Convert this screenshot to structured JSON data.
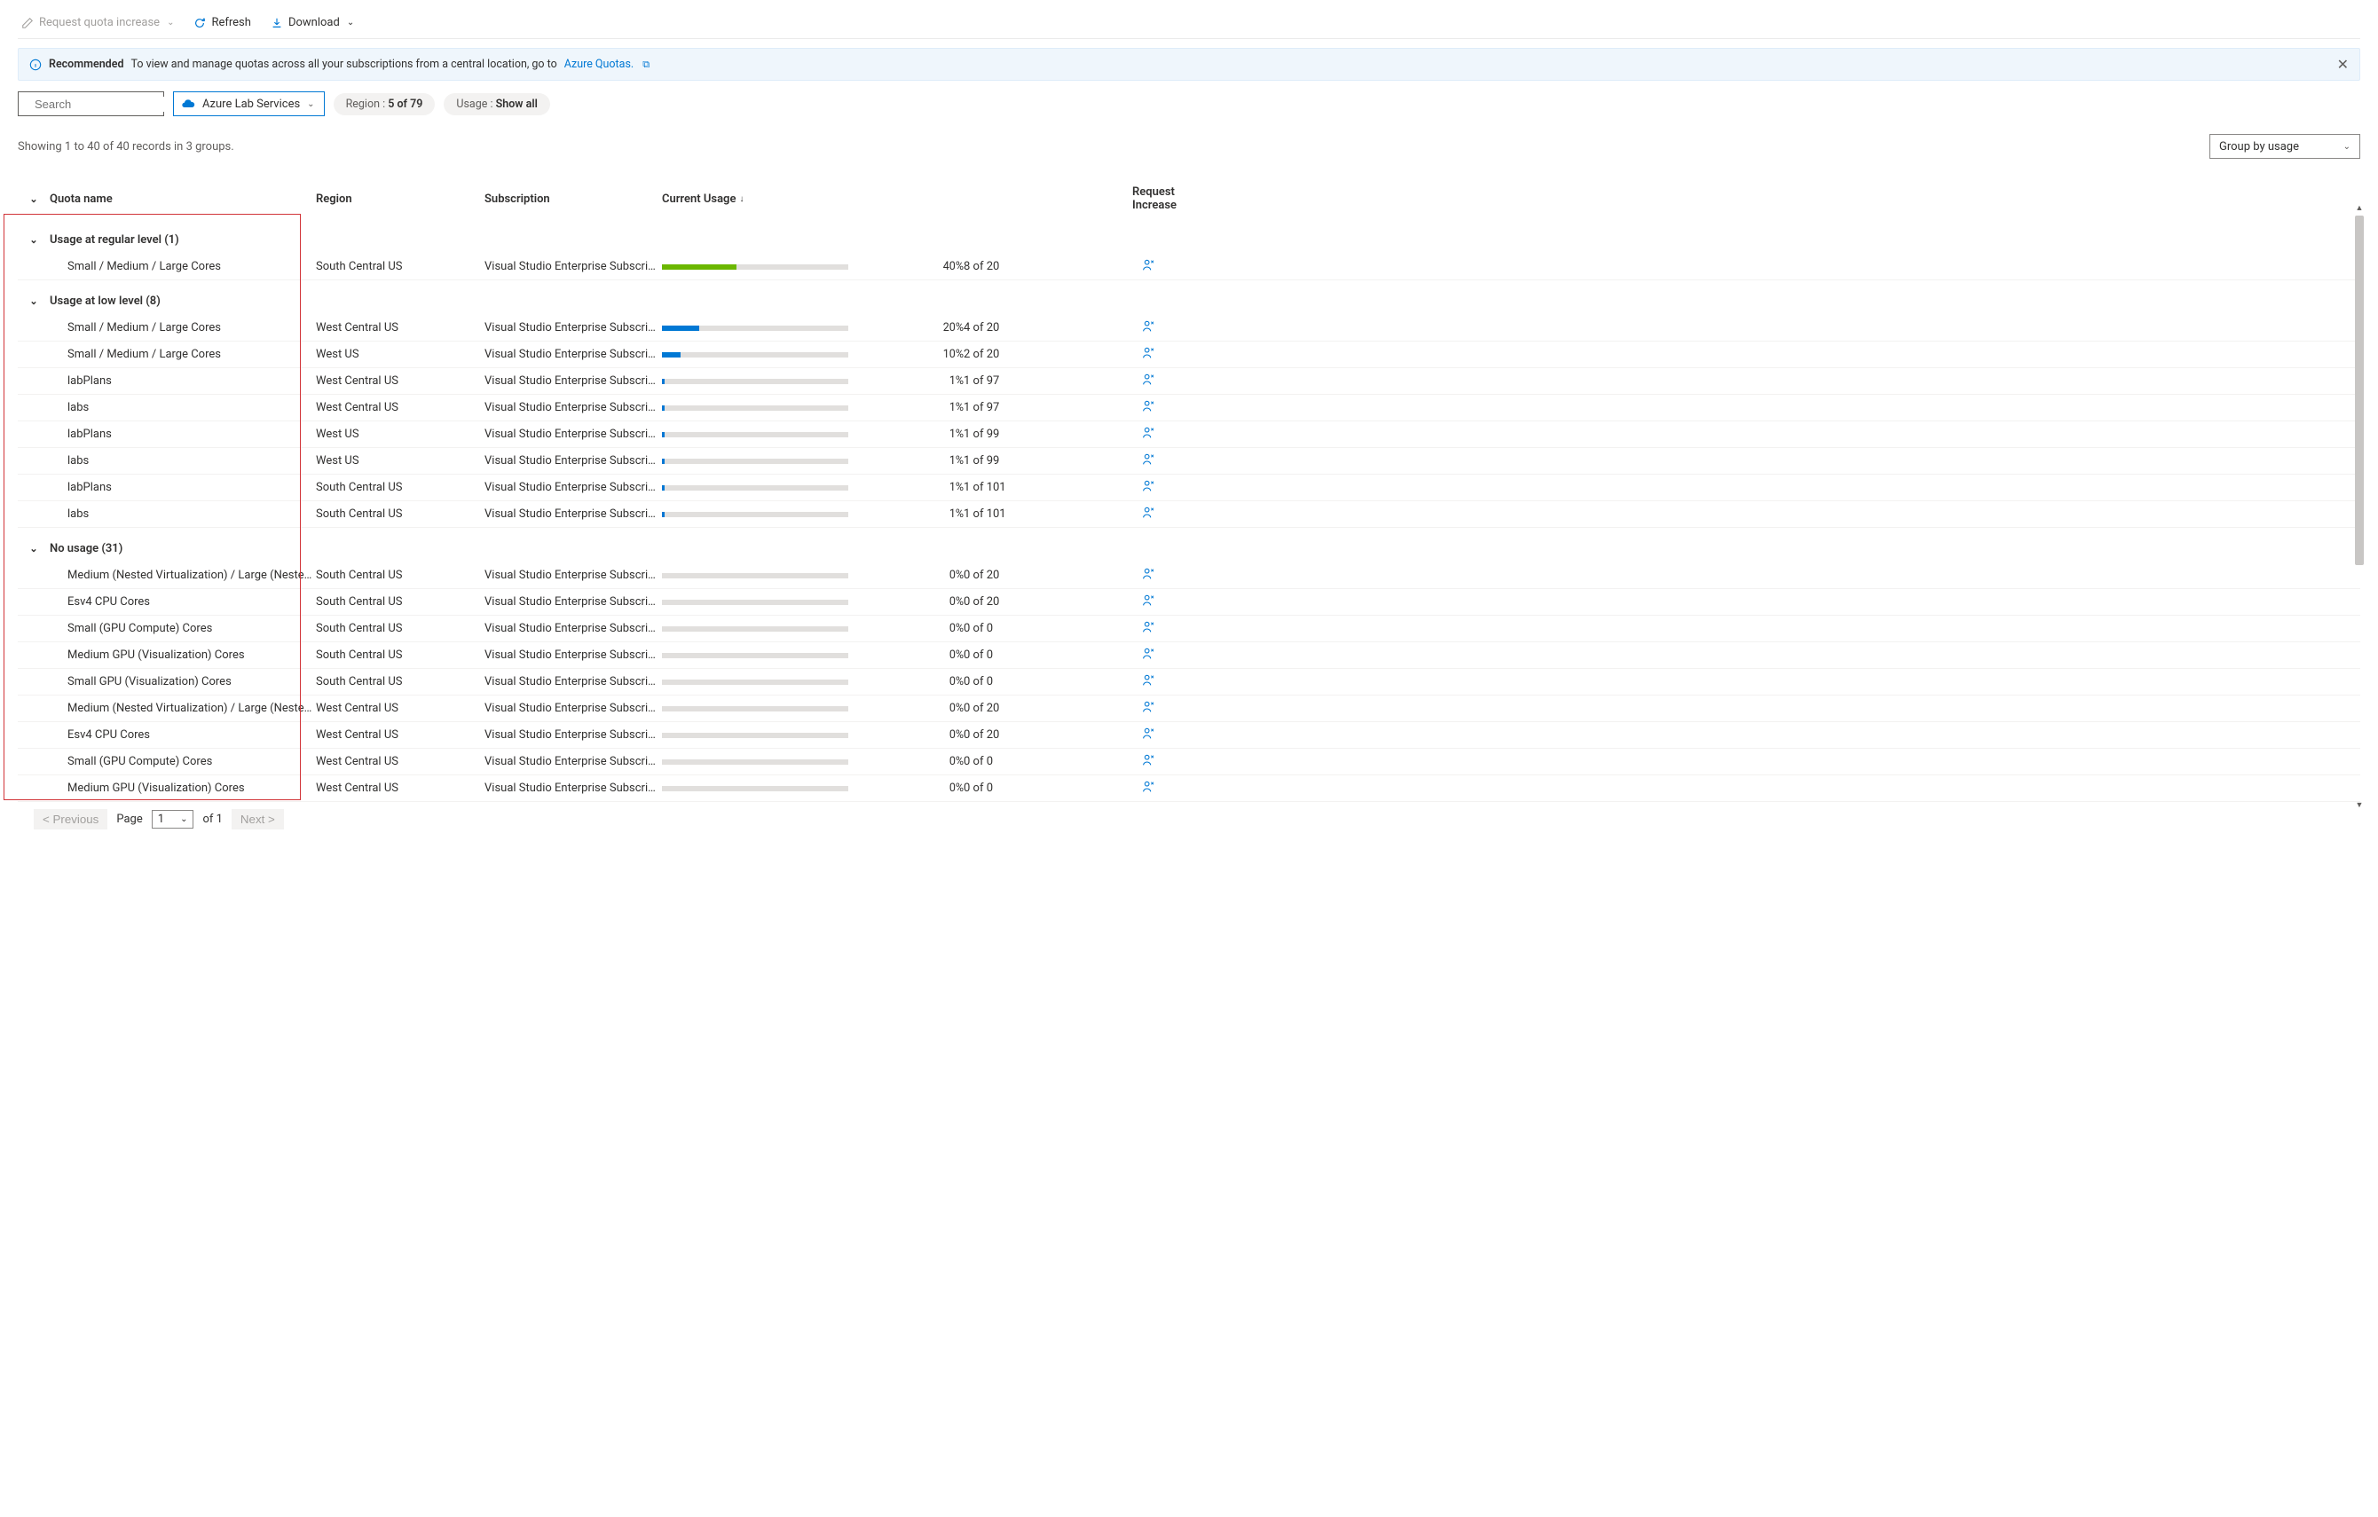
{
  "toolbar": {
    "request_label": "Request quota increase",
    "refresh_label": "Refresh",
    "download_label": "Download"
  },
  "info_bar": {
    "tag": "Recommended",
    "text": "To view and manage quotas across all your subscriptions from a central location, go to ",
    "link": "Azure Quotas."
  },
  "filters": {
    "search_placeholder": "Search",
    "provider": "Azure Lab Services",
    "region_label": "Region : ",
    "region_value": "5 of 79",
    "usage_label": "Usage : ",
    "usage_value": "Show all"
  },
  "count_text": "Showing 1 to 40 of 40 records in 3 groups.",
  "group_by": "Group by usage",
  "headers": {
    "quota": "Quota name",
    "region": "Region",
    "subscription": "Subscription",
    "usage": "Current Usage",
    "request": "Request Increase"
  },
  "groups": [
    {
      "title": "Usage at regular level (1)",
      "rows": [
        {
          "name": "Small / Medium / Large Cores",
          "region": "South Central US",
          "sub": "Visual Studio Enterprise Subscri…",
          "pct": 40,
          "color": "#6bb700",
          "usage": "8 of 20"
        }
      ]
    },
    {
      "title": "Usage at low level (8)",
      "rows": [
        {
          "name": "Small / Medium / Large Cores",
          "region": "West Central US",
          "sub": "Visual Studio Enterprise Subscri…",
          "pct": 20,
          "color": "#0078d4",
          "usage": "4 of 20"
        },
        {
          "name": "Small / Medium / Large Cores",
          "region": "West US",
          "sub": "Visual Studio Enterprise Subscri…",
          "pct": 10,
          "color": "#0078d4",
          "usage": "2 of 20"
        },
        {
          "name": "labPlans",
          "region": "West Central US",
          "sub": "Visual Studio Enterprise Subscri…",
          "pct": 1,
          "color": "#0078d4",
          "usage": "1 of 97"
        },
        {
          "name": "labs",
          "region": "West Central US",
          "sub": "Visual Studio Enterprise Subscri…",
          "pct": 1,
          "color": "#0078d4",
          "usage": "1 of 97"
        },
        {
          "name": "labPlans",
          "region": "West US",
          "sub": "Visual Studio Enterprise Subscri…",
          "pct": 1,
          "color": "#0078d4",
          "usage": "1 of 99"
        },
        {
          "name": "labs",
          "region": "West US",
          "sub": "Visual Studio Enterprise Subscri…",
          "pct": 1,
          "color": "#0078d4",
          "usage": "1 of 99"
        },
        {
          "name": "labPlans",
          "region": "South Central US",
          "sub": "Visual Studio Enterprise Subscri…",
          "pct": 1,
          "color": "#0078d4",
          "usage": "1 of 101"
        },
        {
          "name": "labs",
          "region": "South Central US",
          "sub": "Visual Studio Enterprise Subscri…",
          "pct": 1,
          "color": "#0078d4",
          "usage": "1 of 101"
        }
      ]
    },
    {
      "title": "No usage (31)",
      "rows": [
        {
          "name": "Medium (Nested Virtualization) / Large (Nested …",
          "region": "South Central US",
          "sub": "Visual Studio Enterprise Subscri…",
          "pct": 0,
          "color": "#e1dfdd",
          "usage": "0 of 20"
        },
        {
          "name": "Esv4 CPU Cores",
          "region": "South Central US",
          "sub": "Visual Studio Enterprise Subscri…",
          "pct": 0,
          "color": "#e1dfdd",
          "usage": "0 of 20"
        },
        {
          "name": "Small (GPU Compute) Cores",
          "region": "South Central US",
          "sub": "Visual Studio Enterprise Subscri…",
          "pct": 0,
          "color": "#e1dfdd",
          "usage": "0 of 0"
        },
        {
          "name": "Medium GPU (Visualization) Cores",
          "region": "South Central US",
          "sub": "Visual Studio Enterprise Subscri…",
          "pct": 0,
          "color": "#e1dfdd",
          "usage": "0 of 0"
        },
        {
          "name": "Small GPU (Visualization) Cores",
          "region": "South Central US",
          "sub": "Visual Studio Enterprise Subscri…",
          "pct": 0,
          "color": "#e1dfdd",
          "usage": "0 of 0"
        },
        {
          "name": "Medium (Nested Virtualization) / Large (Nested …",
          "region": "West Central US",
          "sub": "Visual Studio Enterprise Subscri…",
          "pct": 0,
          "color": "#e1dfdd",
          "usage": "0 of 20"
        },
        {
          "name": "Esv4 CPU Cores",
          "region": "West Central US",
          "sub": "Visual Studio Enterprise Subscri…",
          "pct": 0,
          "color": "#e1dfdd",
          "usage": "0 of 20"
        },
        {
          "name": "Small (GPU Compute) Cores",
          "region": "West Central US",
          "sub": "Visual Studio Enterprise Subscri…",
          "pct": 0,
          "color": "#e1dfdd",
          "usage": "0 of 0"
        },
        {
          "name": "Medium GPU (Visualization) Cores",
          "region": "West Central US",
          "sub": "Visual Studio Enterprise Subscri…",
          "pct": 0,
          "color": "#e1dfdd",
          "usage": "0 of 0"
        }
      ]
    }
  ],
  "pager": {
    "prev": "< Previous",
    "page_label": "Page",
    "page_num": "1",
    "of_label": "of 1",
    "next": "Next >"
  }
}
